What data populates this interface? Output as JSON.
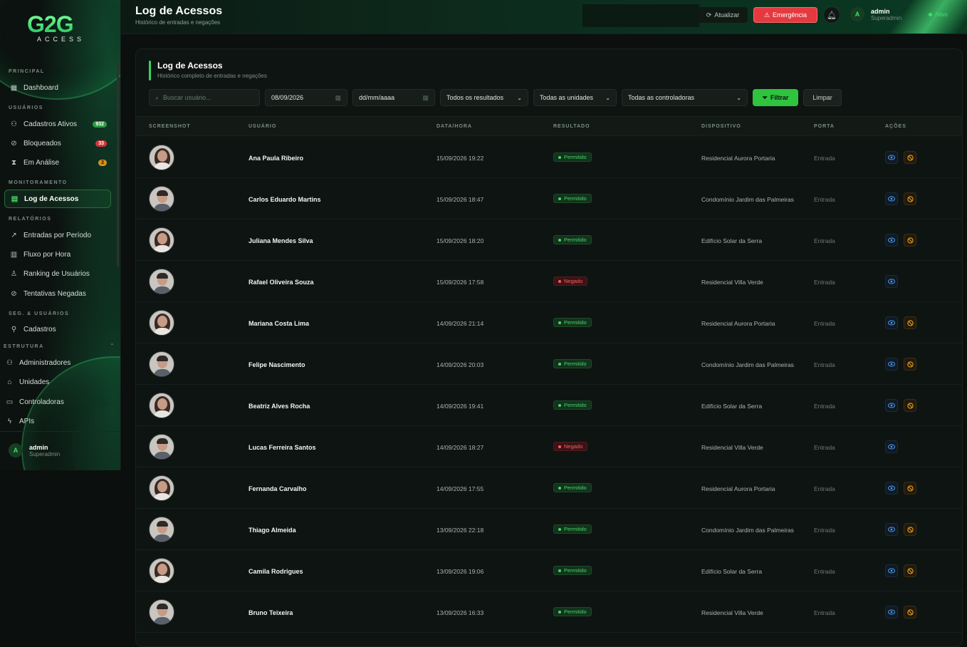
{
  "brand": {
    "logo_main": "G2G",
    "logo_sub": "ACCESS"
  },
  "sidebar": {
    "sections": {
      "principal": "PRINCIPAL",
      "usuarios": "USUÁRIOS",
      "monitoramento": "MONITORAMENTO",
      "relatorios": "RELATÓRIOS",
      "seg_usuarios": "SEG. & USUÁRIOS",
      "estrutura": "ESTRUTURA"
    },
    "items": {
      "dashboard": "Dashboard",
      "cadastros_ativos": "Cadastros Ativos",
      "cadastros_ativos_count": "932",
      "bloqueados": "Bloqueados",
      "bloqueados_count": "33",
      "em_analise": "Em Análise",
      "em_analise_count": "2",
      "log_acessos": "Log de Acessos",
      "entradas_periodo": "Entradas por Período",
      "fluxo_hora": "Fluxo por Hora",
      "ranking": "Ranking de Usuários",
      "tentativas": "Tentativas Negadas",
      "cadastros": "Cadastros",
      "administradores": "Administradores",
      "unidades": "Unidades",
      "controladoras": "Controladoras",
      "apis": "APIs"
    },
    "user": {
      "initial": "A",
      "name": "admin",
      "role": "Superadmin"
    }
  },
  "topbar": {
    "title": "Log de Acessos",
    "subtitle": "Histórico de entradas e negações",
    "refresh": "Atualizar",
    "emergency": "Emergência",
    "user_initial": "A",
    "user_name": "admin",
    "user_role": "Superadmin",
    "status": "Ativo"
  },
  "panel": {
    "title": "Log de Acessos",
    "subtitle": "Histórico completo de entradas e negações",
    "filters": {
      "search_placeholder": "Buscar usuário...",
      "date_from": "08/09/2026",
      "date_to_placeholder": "dd/mm/aaaa",
      "result_select": "Todos os resultados",
      "unit_select": "Todas as unidades",
      "controller_select": "Todas as controladoras",
      "filter_btn": "Filtrar",
      "clear_btn": "Limpar"
    },
    "columns": {
      "screenshot": "SCREENSHOT",
      "usuario": "USUÁRIO",
      "datahora": "DATA/HORA",
      "resultado": "RESULTADO",
      "dispositivo": "DISPOSITIVO",
      "porta": "PORTA",
      "acoes": "AÇÕES"
    }
  },
  "rows": [
    {
      "user": "Ana Paula Ribeiro",
      "datetime": "15/09/2026 19:22",
      "result": "Permitido",
      "device": "Residencial Aurora Portaria",
      "port": "Entrada",
      "gender": "f"
    },
    {
      "user": "Carlos Eduardo Martins",
      "datetime": "15/09/2026 18:47",
      "result": "Permitido",
      "device": "Condomínio Jardim das Palmeiras",
      "port": "Entrada",
      "gender": "m"
    },
    {
      "user": "Juliana Mendes Silva",
      "datetime": "15/09/2026 18:20",
      "result": "Permitido",
      "device": "Edifício Solar da Serra",
      "port": "Entrada",
      "gender": "f"
    },
    {
      "user": "Rafael Oliveira Souza",
      "datetime": "15/09/2026 17:58",
      "result": "Negado",
      "device": "Residencial Villa Verde",
      "port": "Entrada",
      "gender": "m"
    },
    {
      "user": "Mariana Costa Lima",
      "datetime": "14/09/2026 21:14",
      "result": "Permitido",
      "device": "Residencial Aurora Portaria",
      "port": "Entrada",
      "gender": "f"
    },
    {
      "user": "Felipe Nascimento",
      "datetime": "14/09/2026 20:03",
      "result": "Permitido",
      "device": "Condomínio Jardim das Palmeiras",
      "port": "Entrada",
      "gender": "m"
    },
    {
      "user": "Beatriz Alves Rocha",
      "datetime": "14/09/2026 19:41",
      "result": "Permitido",
      "device": "Edifício Solar da Serra",
      "port": "Entrada",
      "gender": "f"
    },
    {
      "user": "Lucas Ferreira Santos",
      "datetime": "14/09/2026 18:27",
      "result": "Negado",
      "device": "Residencial Villa Verde",
      "port": "Entrada",
      "gender": "m"
    },
    {
      "user": "Fernanda Carvalho",
      "datetime": "14/09/2026 17:55",
      "result": "Permitido",
      "device": "Residencial Aurora Portaria",
      "port": "Entrada",
      "gender": "f"
    },
    {
      "user": "Thiago Almeida",
      "datetime": "13/09/2026 22:18",
      "result": "Permitido",
      "device": "Condomínio Jardim das Palmeiras",
      "port": "Entrada",
      "gender": "m"
    },
    {
      "user": "Camila Rodrigues",
      "datetime": "13/09/2026 19:06",
      "result": "Permitido",
      "device": "Edifício Solar da Serra",
      "port": "Entrada",
      "gender": "f"
    },
    {
      "user": "Bruno Teixeira",
      "datetime": "13/09/2026 16:33",
      "result": "Permitido",
      "device": "Residencial Villa Verde",
      "port": "Entrada",
      "gender": "m"
    }
  ],
  "colors": {
    "accent": "#2ec43e",
    "danger": "#e5393f",
    "allowed": "#46d36a",
    "denied": "#ff5a5f"
  }
}
